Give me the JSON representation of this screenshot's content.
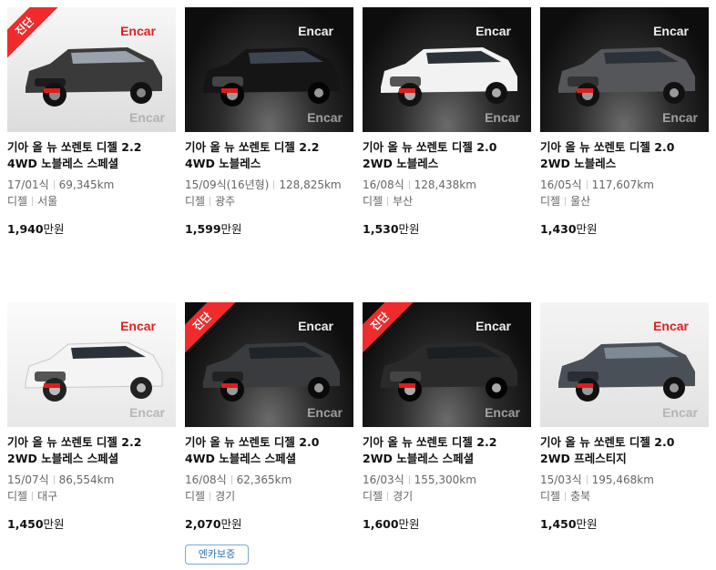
{
  "listings": [
    {
      "title": "기아 올 뉴 쏘렌토 디젤 2.2 4WD 노블레스 스페셜",
      "year": "17/01식",
      "mileage": "69,345km",
      "fuel": "디젤",
      "region": "서울",
      "price": "1,940",
      "unit": "만원",
      "ribbon": "진단",
      "wm_top": "Encar",
      "wm_bottom": "Encar",
      "badge": ""
    },
    {
      "title": "기아 올 뉴 쏘렌토 디젤 2.2 4WD 노블레스",
      "year": "15/09식(16년형)",
      "mileage": "128,825km",
      "fuel": "디젤",
      "region": "광주",
      "price": "1,599",
      "unit": "만원",
      "ribbon": "",
      "wm_top": "Encar",
      "wm_bottom": "Encar",
      "badge": ""
    },
    {
      "title": "기아 올 뉴 쏘렌토 디젤 2.0 2WD 노블레스",
      "year": "16/08식",
      "mileage": "128,438km",
      "fuel": "디젤",
      "region": "부산",
      "price": "1,530",
      "unit": "만원",
      "ribbon": "",
      "wm_top": "Encar",
      "wm_bottom": "Encar",
      "badge": ""
    },
    {
      "title": "기아 올 뉴 쏘렌토 디젤 2.0 2WD 노블레스",
      "year": "16/05식",
      "mileage": "117,607km",
      "fuel": "디젤",
      "region": "울산",
      "price": "1,430",
      "unit": "만원",
      "ribbon": "",
      "wm_top": "Encar",
      "wm_bottom": "Encar",
      "badge": ""
    },
    {
      "title": "기아 올 뉴 쏘렌토 디젤 2.2 2WD 노블레스 스페셜",
      "year": "15/07식",
      "mileage": "86,554km",
      "fuel": "디젤",
      "region": "대구",
      "price": "1,450",
      "unit": "만원",
      "ribbon": "",
      "wm_top": "Encar",
      "wm_bottom": "Encar",
      "badge": ""
    },
    {
      "title": "기아 올 뉴 쏘렌토 디젤 2.0 4WD 노블레스 스페셜",
      "year": "16/08식",
      "mileage": "62,365km",
      "fuel": "디젤",
      "region": "경기",
      "price": "2,070",
      "unit": "만원",
      "ribbon": "진단",
      "wm_top": "Encar",
      "wm_bottom": "Encar",
      "badge": "엔카보증"
    },
    {
      "title": "기아 올 뉴 쏘렌토 디젤 2.2 2WD 노블레스 스페셜",
      "year": "16/03식",
      "mileage": "155,300km",
      "fuel": "디젤",
      "region": "경기",
      "price": "1,600",
      "unit": "만원",
      "ribbon": "진단",
      "wm_top": "Encar",
      "wm_bottom": "Encar",
      "badge": ""
    },
    {
      "title": "기아 올 뉴 쏘렌토 디젤 2.0 2WD 프레스티지",
      "year": "15/03식",
      "mileage": "195,468km",
      "fuel": "디젤",
      "region": "충북",
      "price": "1,450",
      "unit": "만원",
      "ribbon": "",
      "wm_top": "Encar",
      "wm_bottom": "Encar",
      "badge": ""
    }
  ],
  "car_colors": [
    "#3a3a3a",
    "#151515",
    "#f2f2f2",
    "#55565a",
    "#f4f4f4",
    "#3a3b3e",
    "#2a2a2a",
    "#4a5058"
  ],
  "icons": {
    "car_photo": "suv-photo-icon"
  }
}
